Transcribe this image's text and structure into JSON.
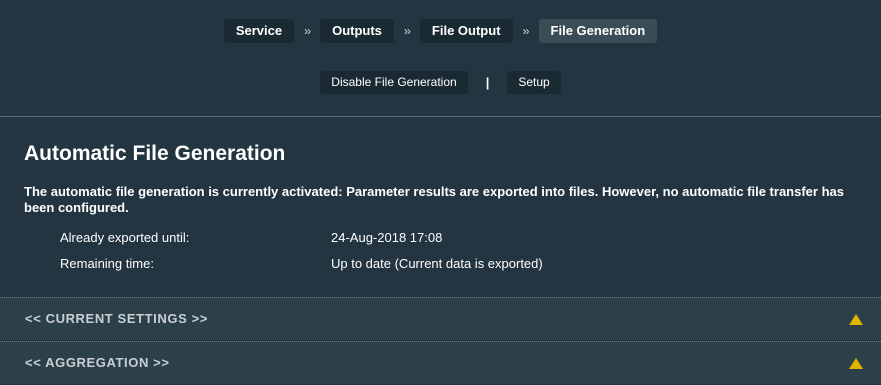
{
  "breadcrumb": {
    "items": [
      "Service",
      "Outputs",
      "File Output",
      "File Generation"
    ],
    "separator": "››"
  },
  "actions": {
    "disable_label": "Disable File Generation",
    "separator": "|",
    "setup_label": "Setup"
  },
  "main": {
    "title": "Automatic File Generation",
    "description": "The automatic file generation is currently activated: Parameter results are exported into files. However, no automatic file transfer has been configured.",
    "exported_label": "Already exported until:",
    "exported_value": "24-Aug-2018 17:08",
    "remaining_label": "Remaining time:",
    "remaining_value": "Up to date (Current data is exported)"
  },
  "sections": [
    {
      "label": "<<  CURRENT SETTINGS  >>",
      "icon": "warning-triangle-icon"
    },
    {
      "label": "<<  AGGREGATION  >>",
      "icon": "warning-triangle-icon"
    }
  ],
  "colors": {
    "background": "#223540",
    "button": "#1a2a32",
    "active_button": "#3a4d57",
    "section_bar": "#2c4049",
    "warning": "#e0b400"
  }
}
